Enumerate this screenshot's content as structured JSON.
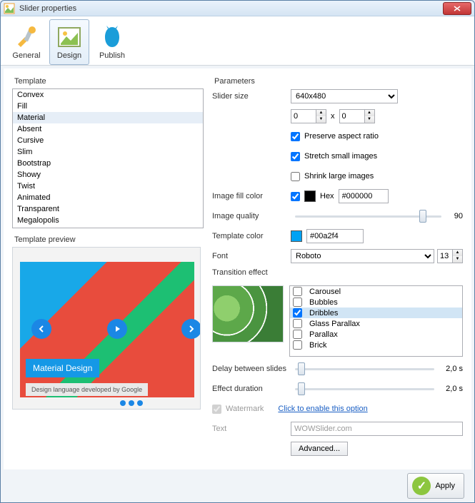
{
  "window": {
    "title": "Slider properties"
  },
  "toolbar": {
    "general": "General",
    "design": "Design",
    "publish": "Publish"
  },
  "left": {
    "template_label": "Template",
    "templates": [
      "Convex",
      "Fill",
      "Material",
      "Absent",
      "Cursive",
      "Slim",
      "Bootstrap",
      "Showy",
      "Twist",
      "Animated",
      "Transparent",
      "Megalopolis"
    ],
    "selected_template_index": 2,
    "preview_label": "Template preview",
    "preview_caption": "Material Design",
    "preview_subcaption": "Design language developed by Google"
  },
  "params": {
    "header": "Parameters",
    "slider_size_label": "Slider size",
    "slider_size_value": "640x480",
    "width_value": "0",
    "height_value": "0",
    "times": "x",
    "preserve": "Preserve aspect ratio",
    "stretch": "Stretch small images",
    "shrink": "Shrink large images",
    "fill_label": "Image fill color",
    "hex_label": "Hex",
    "fill_hex": "#000000",
    "fill_swatch": "#000000",
    "quality_label": "Image quality",
    "quality_value": "90",
    "tcolor_label": "Template color",
    "tcolor_value": "#00a2f4",
    "font_label": "Font",
    "font_value": "Roboto",
    "font_size": "13",
    "transition_label": "Transition effect",
    "effects": [
      "Carousel",
      "Bubbles",
      "Dribbles",
      "Glass Parallax",
      "Parallax",
      "Brick"
    ],
    "effect_selected_index": 2,
    "delay_label": "Delay between slides",
    "delay_value": "2,0 s",
    "duration_label": "Effect duration",
    "duration_value": "2,0 s",
    "watermark_label": "Watermark",
    "watermark_link": "Click to enable this option",
    "text_label": "Text",
    "text_value": "WOWSlider.com",
    "advanced": "Advanced..."
  },
  "footer": {
    "apply": "Apply"
  }
}
